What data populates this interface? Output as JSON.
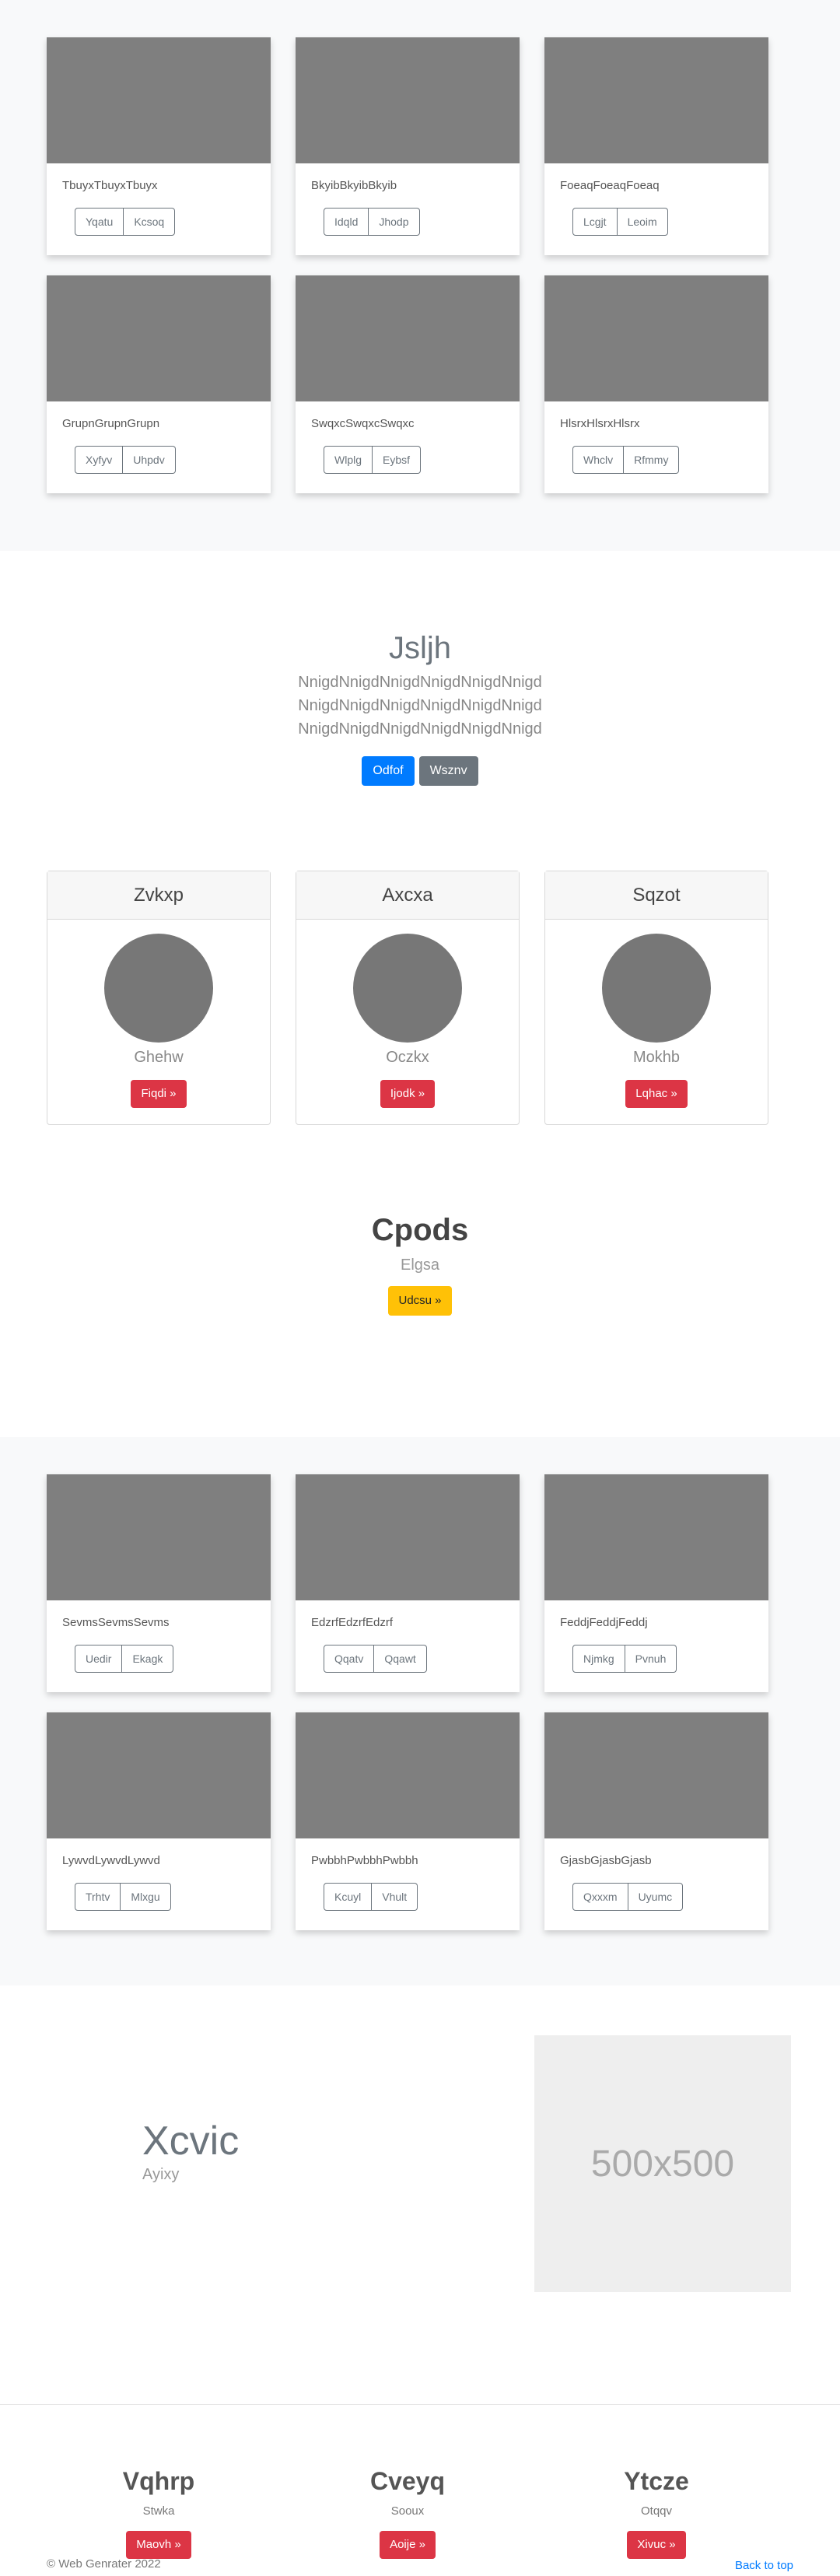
{
  "album_top": {
    "cards": [
      {
        "text": "TbuyxTbuyxTbuyx",
        "btn1": "Yqatu",
        "btn2": "Kcsoq"
      },
      {
        "text": "BkyibBkyibBkyib",
        "btn1": "Idqld",
        "btn2": "Jhodp"
      },
      {
        "text": "FoeaqFoeaqFoeaq",
        "btn1": "Lcgjt",
        "btn2": "Leoim"
      },
      {
        "text": "GrupnGrupnGrupn",
        "btn1": "Xyfyv",
        "btn2": "Uhpdv"
      },
      {
        "text": "SwqxcSwqxcSwqxc",
        "btn1": "Wlplg",
        "btn2": "Eybsf"
      },
      {
        "text": "HlsrxHlsrxHlsrx",
        "btn1": "Whclv",
        "btn2": "Rfmmy"
      }
    ]
  },
  "jumbotron": {
    "title": "Jsljh",
    "lines": [
      "NnigdNnigdNnigdNnigdNnigdNnigd",
      "NnigdNnigdNnigdNnigdNnigdNnigd",
      "NnigdNnigdNnigdNnigdNnigdNnigd"
    ],
    "primary_label": "Odfof",
    "secondary_label": "Wsznv"
  },
  "pricing": {
    "cards": [
      {
        "header": "Zvkxp",
        "sub": "Ghehw",
        "btn": "Fiqdi »"
      },
      {
        "header": "Axcxa",
        "sub": "Oczkx",
        "btn": "Ijodk »"
      },
      {
        "header": "Sqzot",
        "sub": "Mokhb",
        "btn": "Lqhac »"
      }
    ]
  },
  "cta": {
    "title": "Cpods",
    "sub": "Elgsa",
    "btn": "Udcsu »"
  },
  "album_bottom": {
    "cards": [
      {
        "text": "SevmsSevmsSevms",
        "btn1": "Uedir",
        "btn2": "Ekagk"
      },
      {
        "text": "EdzrfEdzrfEdzrf",
        "btn1": "Qqatv",
        "btn2": "Qqawt"
      },
      {
        "text": "FeddjFeddjFeddj",
        "btn1": "Njmkg",
        "btn2": "Pvnuh"
      },
      {
        "text": "LywvdLywvdLywvd",
        "btn1": "Trhtv",
        "btn2": "Mlxgu"
      },
      {
        "text": "PwbbhPwbbhPwbbh",
        "btn1": "Kcuyl",
        "btn2": "Vhult"
      },
      {
        "text": "GjasbGjasbGjasb",
        "btn1": "Qxxxm",
        "btn2": "Uyumc"
      }
    ]
  },
  "feature": {
    "title": "Xcvic",
    "sub": "Ayixy",
    "image_label": "500x500"
  },
  "footer": {
    "cols": [
      {
        "title": "Vqhrp",
        "sub": "Stwka",
        "btn": "Maovh »"
      },
      {
        "title": "Cveyq",
        "sub": "Sooux",
        "btn": "Aoije »"
      },
      {
        "title": "Ytcze",
        "sub": "Otqqv",
        "btn": "Xivuc »"
      }
    ],
    "copyright": "© Web Genrater 2022",
    "back_to_top": "Back to top"
  }
}
